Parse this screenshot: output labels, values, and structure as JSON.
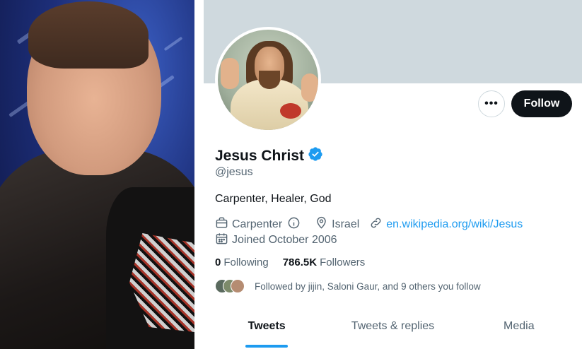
{
  "profile": {
    "name": "Jesus Christ",
    "handle": "@jesus",
    "bio": "Carpenter, Healer, God",
    "verified_icon": "verified-badge-icon",
    "profession": "Carpenter",
    "location": "Israel",
    "website": "en.wikipedia.org/wiki/Jesus",
    "joined": "Joined October 2006"
  },
  "actions": {
    "more_label": "•••",
    "follow_label": "Follow"
  },
  "stats": {
    "following_count": "0",
    "following_label": "Following",
    "followers_count": "786.5K",
    "followers_label": "Followers"
  },
  "followed_by": "Followed by jijin, Saloni Gaur, and 9 others you follow",
  "tabs": [
    {
      "label": "Tweets",
      "active": true
    },
    {
      "label": "Tweets & replies",
      "active": false
    },
    {
      "label": "Media",
      "active": false
    }
  ],
  "colors": {
    "accent": "#1d9bf0",
    "follow_button": "#0f1419",
    "banner": "#cfd9de",
    "secondary_text": "#536471"
  }
}
